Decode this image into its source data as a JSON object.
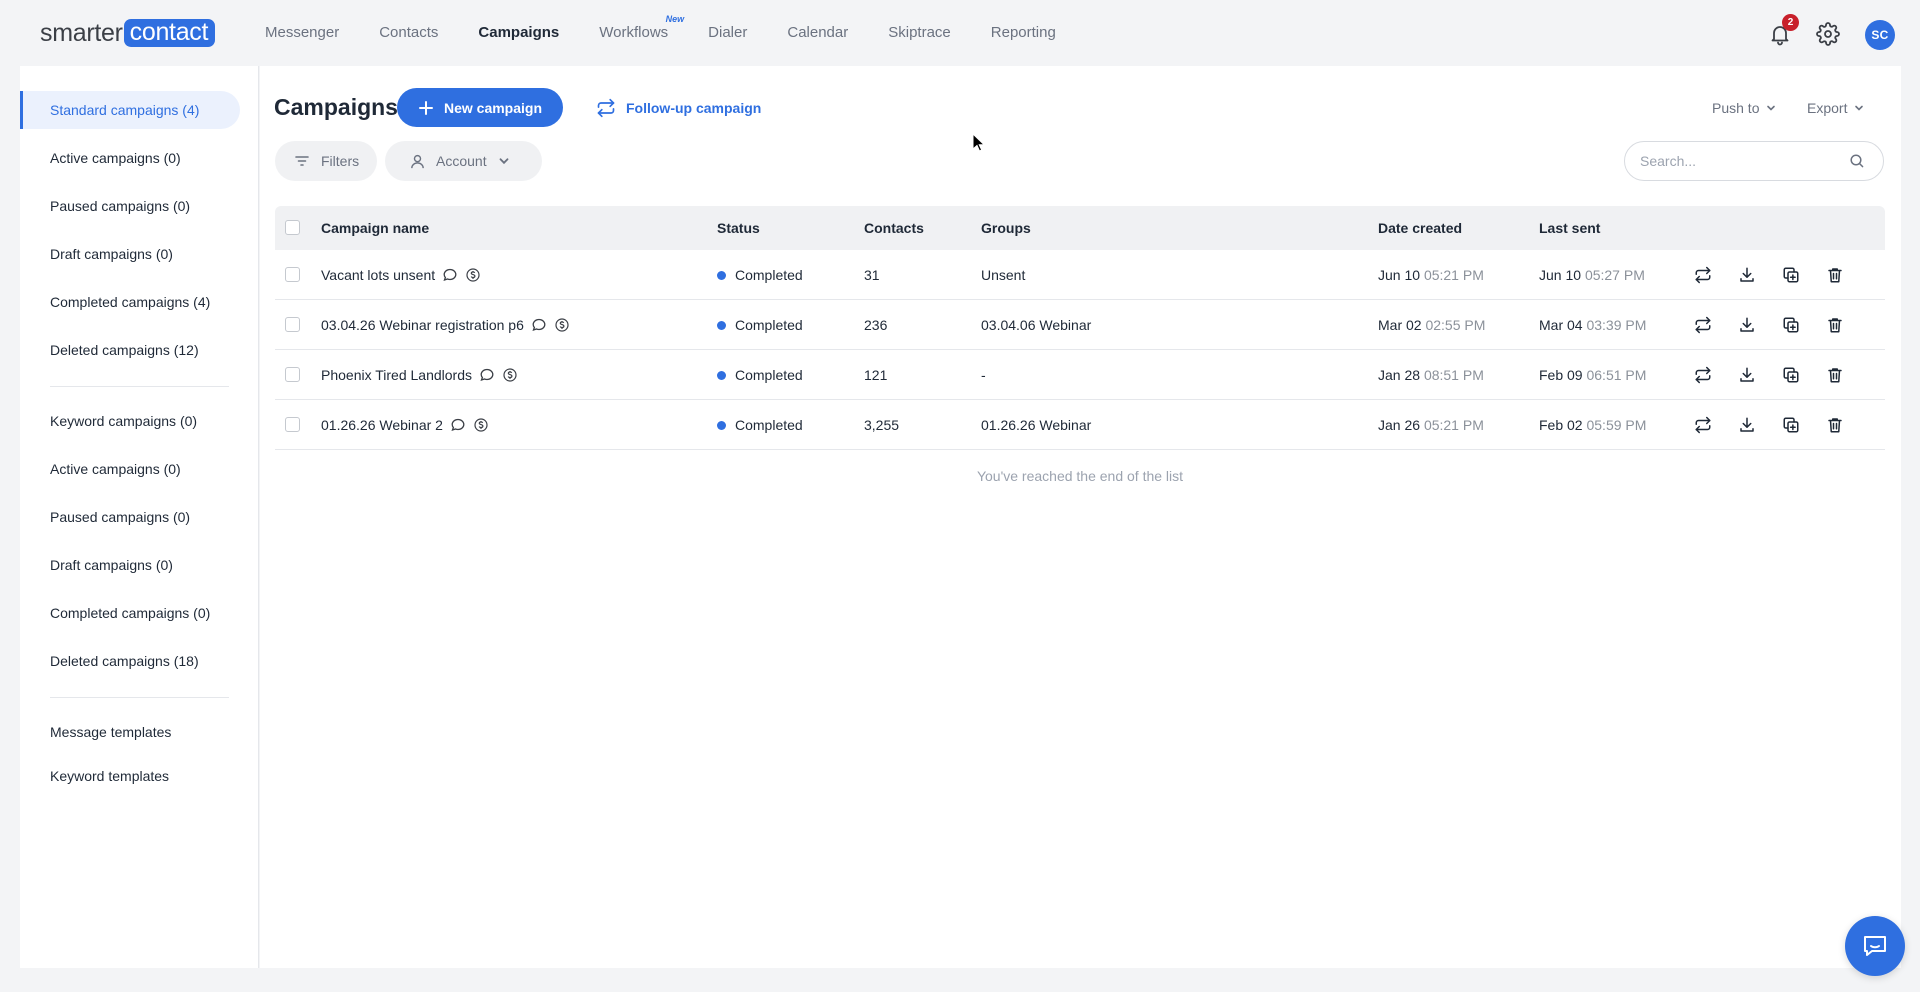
{
  "brand": {
    "logo_part1": "smarter",
    "logo_part2": "contact"
  },
  "nav": {
    "items": [
      {
        "label": "Messenger"
      },
      {
        "label": "Contacts"
      },
      {
        "label": "Campaigns",
        "active": true
      },
      {
        "label": "Workflows",
        "badge": "New"
      },
      {
        "label": "Dialer"
      },
      {
        "label": "Calendar"
      },
      {
        "label": "Skiptrace"
      },
      {
        "label": "Reporting"
      }
    ]
  },
  "header_right": {
    "notification_count": "2",
    "avatar_initials": "SC"
  },
  "sidebar": {
    "standard": [
      {
        "label": "Standard campaigns (4)",
        "active": true
      },
      {
        "label": "Active campaigns (0)"
      },
      {
        "label": "Paused campaigns (0)"
      },
      {
        "label": "Draft campaigns (0)"
      },
      {
        "label": "Completed campaigns (4)"
      },
      {
        "label": "Deleted campaigns (12)"
      }
    ],
    "keyword": [
      {
        "label": "Keyword campaigns (0)"
      },
      {
        "label": "Active campaigns (0)"
      },
      {
        "label": "Paused campaigns (0)"
      },
      {
        "label": "Draft campaigns (0)"
      },
      {
        "label": "Completed campaigns (0)"
      },
      {
        "label": "Deleted campaigns (18)"
      }
    ],
    "templates": [
      {
        "label": "Message templates"
      },
      {
        "label": "Keyword templates"
      }
    ]
  },
  "main": {
    "title": "Campaigns",
    "new_campaign_label": "New campaign",
    "follow_up_label": "Follow-up campaign",
    "push_to_label": "Push to",
    "export_label": "Export",
    "filters_label": "Filters",
    "account_label": "Account",
    "search_placeholder": "Search..."
  },
  "table": {
    "headers": {
      "name": "Campaign name",
      "status": "Status",
      "contacts": "Contacts",
      "groups": "Groups",
      "date_created": "Date created",
      "last_sent": "Last sent"
    },
    "rows": [
      {
        "name": "Vacant lots unsent",
        "status": "Completed",
        "contacts": "31",
        "groups": "Unsent",
        "created_date": "Jun 10",
        "created_time": "05:21 PM",
        "sent_date": "Jun 10",
        "sent_time": "05:27 PM"
      },
      {
        "name": "03.04.26 Webinar registration p6",
        "status": "Completed",
        "contacts": "236",
        "groups": "03.04.06 Webinar",
        "created_date": "Mar 02",
        "created_time": "02:55 PM",
        "sent_date": "Mar 04",
        "sent_time": "03:39 PM"
      },
      {
        "name": "Phoenix Tired Landlords",
        "status": "Completed",
        "contacts": "121",
        "groups": "-",
        "created_date": "Jan 28",
        "created_time": "08:51 PM",
        "sent_date": "Feb 09",
        "sent_time": "06:51 PM"
      },
      {
        "name": "01.26.26 Webinar 2",
        "status": "Completed",
        "contacts": "3,255",
        "groups": "01.26.26 Webinar",
        "created_date": "Jan 26",
        "created_time": "05:21 PM",
        "sent_date": "Feb 02",
        "sent_time": "05:59 PM"
      }
    ],
    "end_note": "You've reached the end of the list"
  },
  "colors": {
    "accent": "#2f6fe0",
    "badge_red": "#c8202b",
    "status_completed": "#2f6fe0"
  }
}
